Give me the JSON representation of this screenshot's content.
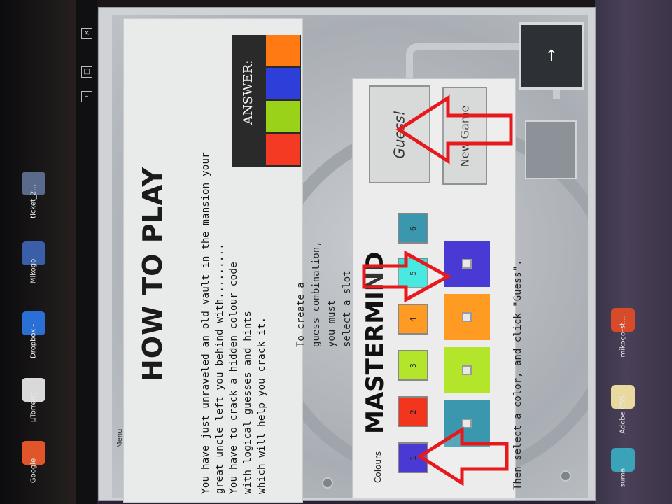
{
  "desktop": {
    "icons": [
      {
        "label": "Google",
        "color": "#e0562a"
      },
      {
        "label": "µTorrent",
        "color": "#d9d9d9"
      },
      {
        "label": "Dropbox -",
        "color": "#2a6fd6"
      },
      {
        "label": "Mikogo",
        "color": "#3a5ea8"
      },
      {
        "label": "ticket_2...",
        "color": "#5a6a8a"
      },
      {
        "label": "mikogo-st...",
        "color": "#d84b2a"
      },
      {
        "label": "Adobe CSS",
        "color": "#e8d9a0"
      },
      {
        "label": "suma",
        "color": "#3aa3b8"
      }
    ],
    "window_controls": {
      "close": "×",
      "maximize": "□",
      "minimize": "–"
    }
  },
  "screen": {
    "menu_label": "Menu",
    "nav_prev_label": "↓",
    "nav_next_label": "↑"
  },
  "instructions": {
    "title": "HOW TO PLAY",
    "lines": [
      "You have just unraveled an old vault in the mansion your",
      "great uncle left you behind with.........",
      "You have to crack a hidden colour code",
      "with logical guesses and hints",
      "which will help you crack it."
    ],
    "answer_label": "ANSWER:",
    "answer_colors": [
      "#ff7a12",
      "#2d3fd8",
      "#9ad21a",
      "#f43a22"
    ]
  },
  "game": {
    "title": "MASTERMIND",
    "colours_label": "Colours",
    "hint_lines": [
      "To create a",
      "guess combination,",
      "you must",
      "select a slot"
    ],
    "then_line": "Then select a color, and click \"Guess\".",
    "palette": [
      {
        "num": "1",
        "color": "#4a3ad4"
      },
      {
        "num": "2",
        "color": "#f2361e"
      },
      {
        "num": "3",
        "color": "#b3e62a"
      },
      {
        "num": "4",
        "color": "#ff9a22"
      },
      {
        "num": "5",
        "color": "#27e6dc"
      },
      {
        "num": "6",
        "color": "#3a97ad"
      }
    ],
    "slots": [
      "#3a97ad",
      "#b3e62a",
      "#ff9a22",
      "#4a3ad4"
    ],
    "guess_button": "Guess!",
    "new_game_button": "New Game"
  }
}
